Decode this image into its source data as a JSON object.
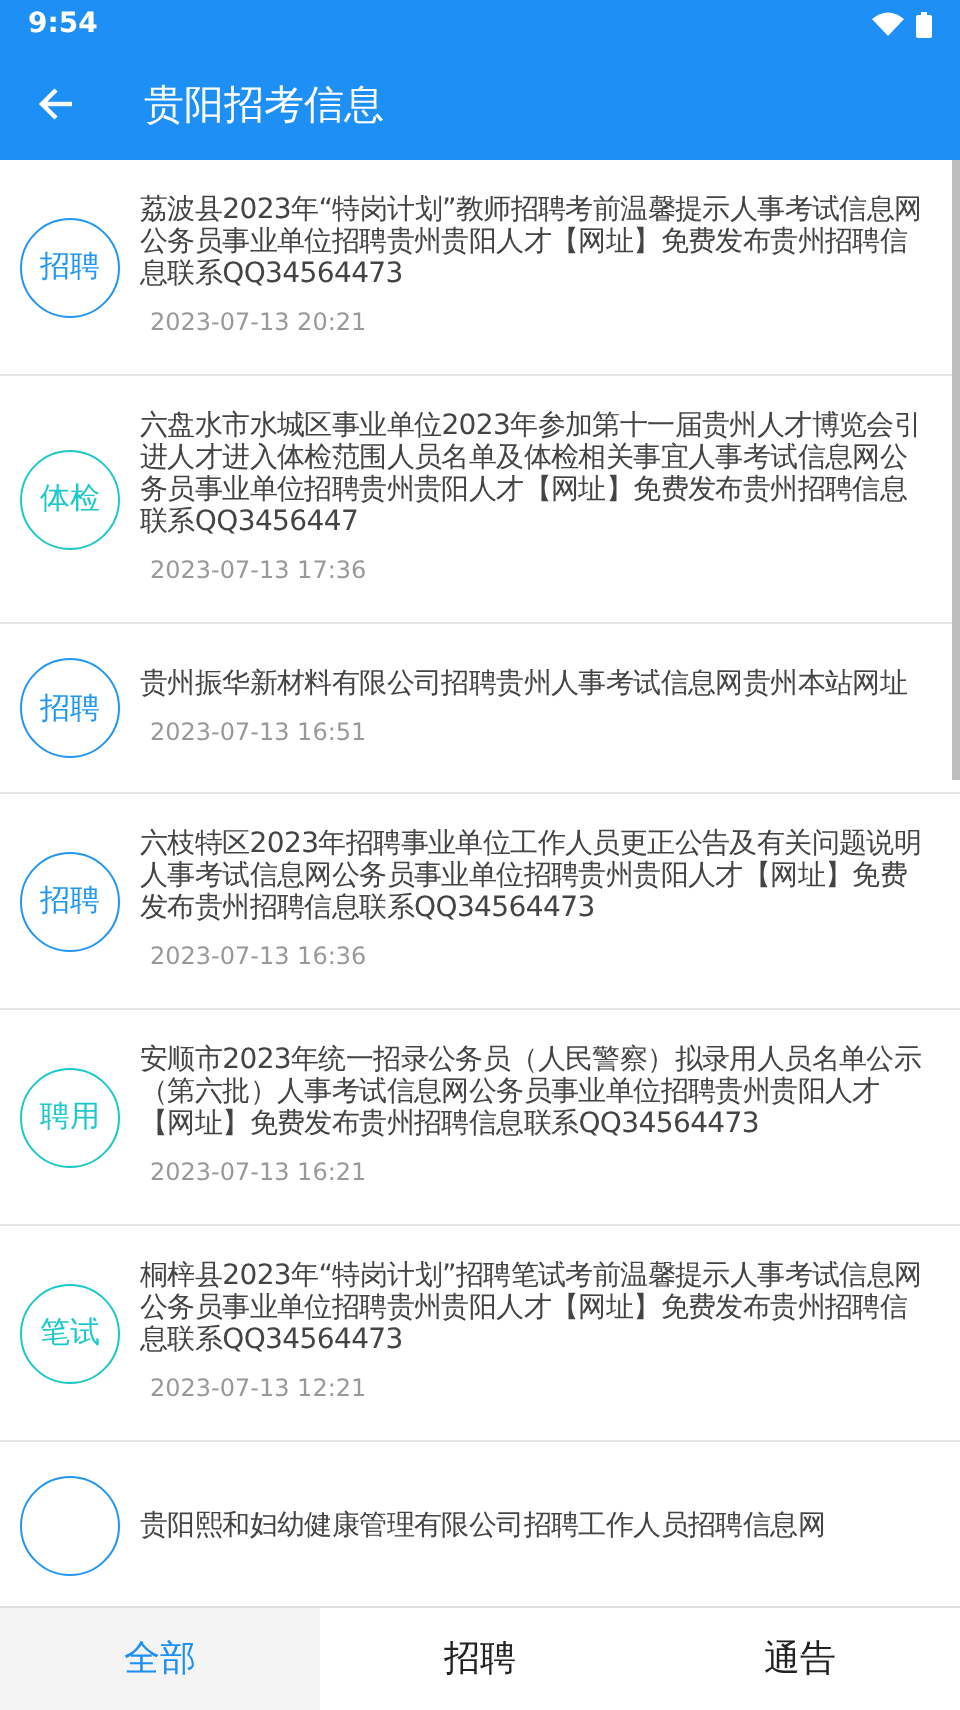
{
  "status_bar": {
    "time": "9:54"
  },
  "app_bar": {
    "title": "贵阳招考信息"
  },
  "items": [
    {
      "badge": "招聘",
      "color": "#2196f3",
      "title": "荔波县2023年“特岗计划”教师招聘考前温馨提示人事考试信息网公务员事业单位招聘贵州贵阳人才【网址】免费发布贵州招聘信息联系QQ34564473",
      "date": "2023-07-13 20:21"
    },
    {
      "badge": "体检",
      "color": "#1dc8c8",
      "title": "六盘水市水城区事业单位2023年参加第十一届贵州人才博览会引进人才进入体检范围人员名单及体检相关事宜人事考试信息网公务员事业单位招聘贵州贵阳人才【网址】免费发布贵州招聘信息联系QQ3456447",
      "date": "2023-07-13 17:36"
    },
    {
      "badge": "招聘",
      "color": "#2196f3",
      "title": "贵州振华新材料有限公司招聘贵州人事考试信息网贵州本站网址",
      "date": "2023-07-13 16:51"
    },
    {
      "badge": "招聘",
      "color": "#2196f3",
      "title": "六枝特区2023年招聘事业单位工作人员更正公告及有关问题说明人事考试信息网公务员事业单位招聘贵州贵阳人才【网址】免费发布贵州招聘信息联系QQ34564473",
      "date": "2023-07-13 16:36"
    },
    {
      "badge": "聘用",
      "color": "#1dc8c8",
      "title": "安顺市2023年统一招录公务员（人民警察）拟录用人员名单公示（第六批）人事考试信息网公务员事业单位招聘贵州贵阳人才【网址】免费发布贵州招聘信息联系QQ34564473",
      "date": "2023-07-13 16:21"
    },
    {
      "badge": "笔试",
      "color": "#1dc8c8",
      "title": "桐梓县2023年“特岗计划”招聘笔试考前温馨提示人事考试信息网公务员事业单位招聘贵州贵阳人才【网址】免费发布贵州招聘信息联系QQ34564473",
      "date": "2023-07-13 12:21"
    },
    {
      "color": "#2196f3",
      "title": "贵阳熙和妇幼健康管理有限公司招聘工作人员招聘信息网"
    }
  ],
  "tabs": [
    {
      "label": "全部",
      "selected": true
    },
    {
      "label": "招聘",
      "selected": false
    },
    {
      "label": "通告",
      "selected": false
    }
  ]
}
